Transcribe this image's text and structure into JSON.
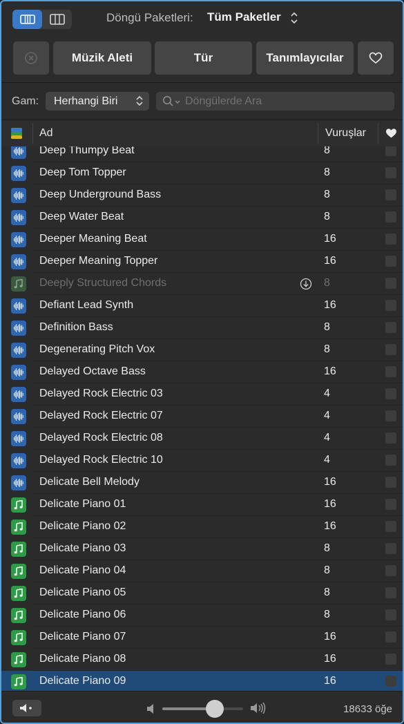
{
  "toolbar": {
    "pack_label": "Döngü Paketleri:",
    "pack_value": "Tüm Paketler"
  },
  "filters": {
    "instrument": "Müzik Aleti",
    "genre": "Tür",
    "descriptors": "Tanımlayıcılar"
  },
  "scale": {
    "label": "Gam:",
    "value": "Herhangi Biri"
  },
  "search": {
    "placeholder": "Döngülerde Ara"
  },
  "table": {
    "col_name": "Ad",
    "col_beats": "Vuruşlar",
    "rows": [
      {
        "name": "Deep Thumpy Beat",
        "beats": "8",
        "type": "audio"
      },
      {
        "name": "Deep Tom Topper",
        "beats": "8",
        "type": "audio"
      },
      {
        "name": "Deep Underground Bass",
        "beats": "8",
        "type": "audio"
      },
      {
        "name": "Deep Water Beat",
        "beats": "8",
        "type": "audio"
      },
      {
        "name": "Deeper Meaning Beat",
        "beats": "16",
        "type": "audio"
      },
      {
        "name": "Deeper Meaning Topper",
        "beats": "16",
        "type": "audio"
      },
      {
        "name": "Deeply Structured Chords",
        "beats": "8",
        "type": "midi",
        "state": "not-downloaded"
      },
      {
        "name": "Defiant Lead Synth",
        "beats": "16",
        "type": "audio"
      },
      {
        "name": "Definition Bass",
        "beats": "8",
        "type": "audio"
      },
      {
        "name": "Degenerating Pitch Vox",
        "beats": "8",
        "type": "audio"
      },
      {
        "name": "Delayed Octave Bass",
        "beats": "16",
        "type": "audio"
      },
      {
        "name": "Delayed Rock Electric 03",
        "beats": "4",
        "type": "audio"
      },
      {
        "name": "Delayed Rock Electric 07",
        "beats": "4",
        "type": "audio"
      },
      {
        "name": "Delayed Rock Electric 08",
        "beats": "4",
        "type": "audio"
      },
      {
        "name": "Delayed Rock Electric 10",
        "beats": "4",
        "type": "audio"
      },
      {
        "name": "Delicate Bell Melody",
        "beats": "16",
        "type": "audio"
      },
      {
        "name": "Delicate Piano 01",
        "beats": "16",
        "type": "midi"
      },
      {
        "name": "Delicate Piano 02",
        "beats": "16",
        "type": "midi"
      },
      {
        "name": "Delicate Piano 03",
        "beats": "8",
        "type": "midi"
      },
      {
        "name": "Delicate Piano 04",
        "beats": "8",
        "type": "midi"
      },
      {
        "name": "Delicate Piano 05",
        "beats": "8",
        "type": "midi"
      },
      {
        "name": "Delicate Piano 06",
        "beats": "8",
        "type": "midi"
      },
      {
        "name": "Delicate Piano 07",
        "beats": "16",
        "type": "midi"
      },
      {
        "name": "Delicate Piano 08",
        "beats": "16",
        "type": "midi"
      },
      {
        "name": "Delicate Piano 09",
        "beats": "16",
        "type": "midi",
        "state": "selected"
      }
    ]
  },
  "footer": {
    "item_count": "18633 öğe",
    "volume": 0.65
  },
  "colors": {
    "accent": "#3a78c8",
    "audio_loop": "#2e67b0",
    "midi_loop": "#2f9a47",
    "selection": "#204a78"
  },
  "icons": {
    "view_mode_list": "list-view-icon",
    "view_mode_columns": "column-view-icon",
    "clear_filters": "clear-filters-icon",
    "favorites": "heart-icon",
    "speaker": "speaker-icon"
  }
}
